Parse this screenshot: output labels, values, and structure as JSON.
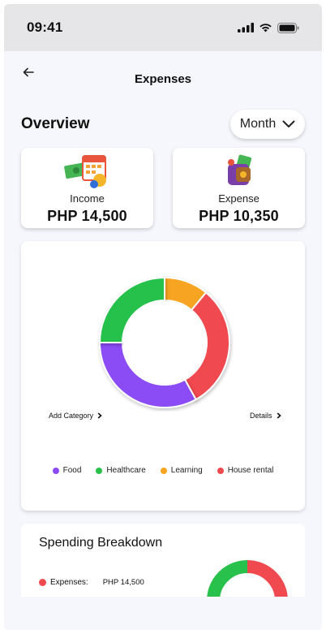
{
  "status": {
    "time": "09:41"
  },
  "header": {
    "title": "Expenses"
  },
  "overview": {
    "title": "Overview",
    "period": "Month"
  },
  "income": {
    "label": "Income",
    "amount": "PHP 14,500"
  },
  "expense": {
    "label": "Expense",
    "amount": "PHP 10,350"
  },
  "chart_data": {
    "type": "pie",
    "style": "donut",
    "categories": [
      "Learning",
      "House rental",
      "Food",
      "Healthcare"
    ],
    "values": [
      11,
      31,
      33,
      25
    ],
    "colors": [
      "#f6a421",
      "#f04a50",
      "#8b4cf5",
      "#28c14b"
    ],
    "legend": [
      "Food",
      "Healthcare",
      "Learning",
      "House rental"
    ],
    "legend_colors": [
      "#8b4cf5",
      "#28c14b",
      "#f6a421",
      "#f04a50"
    ],
    "legend_position": "bottom"
  },
  "chart_links": {
    "add_category": "Add Category",
    "details": "Details"
  },
  "breakdown": {
    "title": "Spending Breakdown",
    "row_label": "Expenses:",
    "row_value": "PHP 14,500"
  }
}
